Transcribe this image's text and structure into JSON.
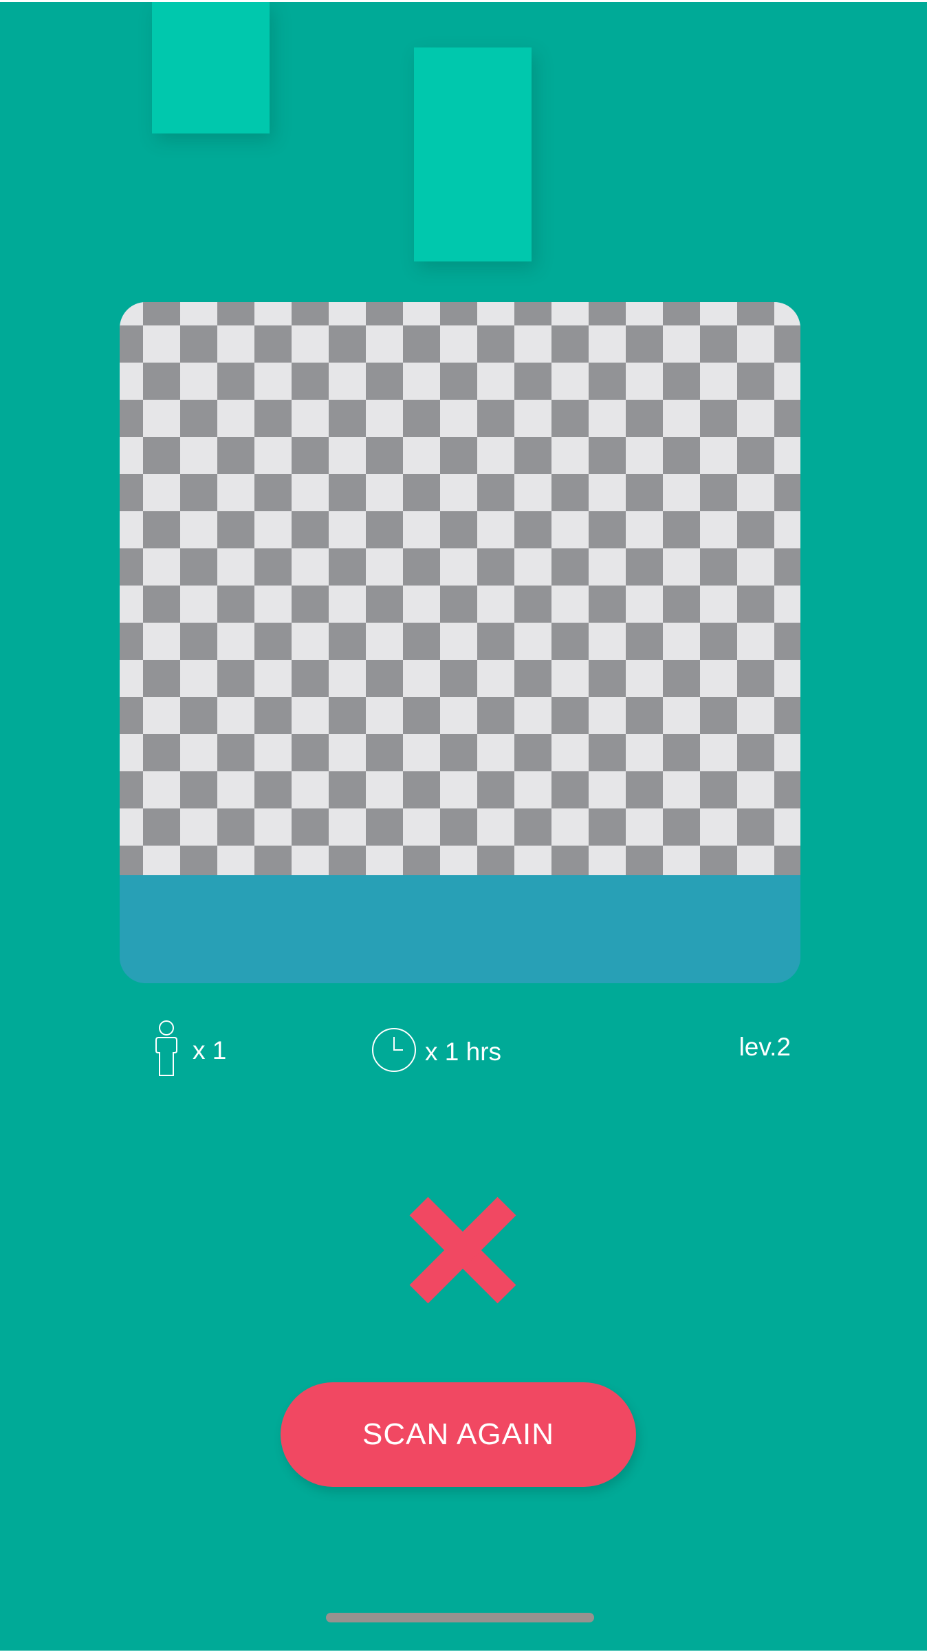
{
  "colors": {
    "background": "#00aa97",
    "decorative_blocks": "#00c8ad",
    "card_footer": "#28a0b6",
    "checker_dark": "#929396",
    "checker_light": "#e6e6e8",
    "accent_red": "#f14862",
    "text": "#ffffff"
  },
  "card": {
    "image_placeholder_icon": "transparency-checkerboard"
  },
  "stats": {
    "players": {
      "icon": "person-icon",
      "label": "x 1"
    },
    "duration": {
      "icon": "clock-icon",
      "label": "x 1 hrs"
    },
    "level": {
      "label": "lev.2"
    }
  },
  "result": {
    "icon": "close-icon"
  },
  "actions": {
    "scan_again_label": "SCAN AGAIN"
  }
}
